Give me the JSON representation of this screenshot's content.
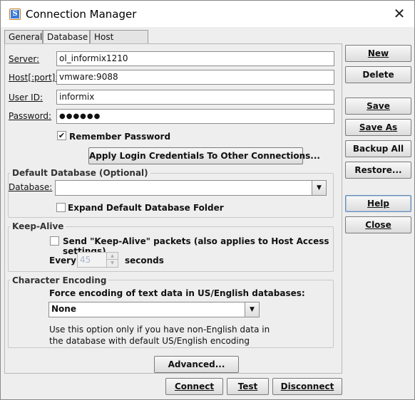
{
  "window": {
    "title": "Connection Manager",
    "close_glyph": "✕"
  },
  "tabs": [
    {
      "label": "General"
    },
    {
      "label": "Database"
    },
    {
      "label": "Host Access"
    }
  ],
  "form": {
    "server_label": "Server:",
    "server_value": "ol_informix1210",
    "host_label": "Host[:port]:",
    "host_value": "vmware:9088",
    "userid_label": "User ID:",
    "userid_value": "informix",
    "password_label": "Password:",
    "password_value": "●●●●●●",
    "remember_label": "Remember Password",
    "remember_checked": true,
    "apply_button": "Apply Login Credentials To Other Connections..."
  },
  "default_db": {
    "group_title": "Default Database (Optional)",
    "database_label": "Database:",
    "database_value": "",
    "expand_label": "Expand Default Database Folder",
    "expand_checked": false
  },
  "keep_alive": {
    "group_title": "Keep-Alive",
    "send_label": "Send \"Keep-Alive\" packets (also applies to Host Access settings)",
    "send_checked": false,
    "every_label": "Every",
    "every_value": "45",
    "seconds_label": "seconds"
  },
  "encoding": {
    "group_title": "Character Encoding",
    "force_label": "Force encoding of text data in US/English databases:",
    "selected": "None",
    "note_line1": "Use this option only if you have non-English data in",
    "note_line2": "the database with default US/English encoding"
  },
  "advanced_button": "Advanced...",
  "bottom_buttons": {
    "connect": "Connect",
    "test": "Test",
    "disconnect": "Disconnect"
  },
  "side_buttons": {
    "new": "New",
    "delete": "Delete",
    "save": "Save",
    "save_as": "Save As",
    "backup_all": "Backup All",
    "restore": "Restore...",
    "help": "Help",
    "close": "Close"
  }
}
